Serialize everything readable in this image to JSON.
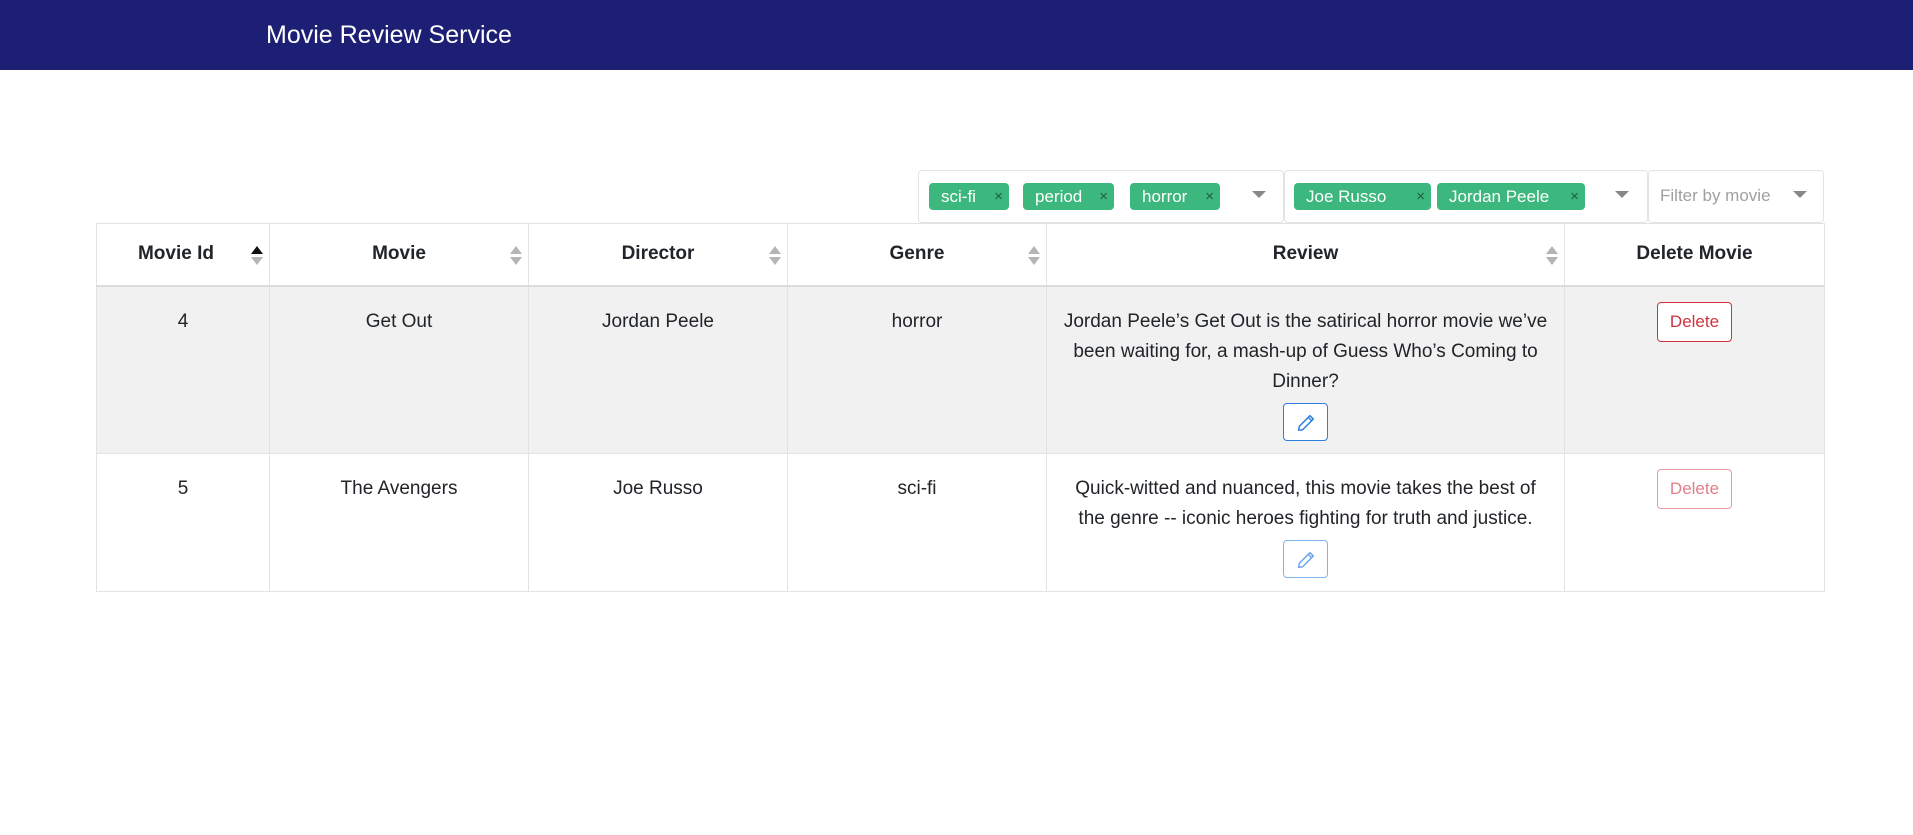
{
  "app": {
    "title": "Movie Review Service"
  },
  "filters": {
    "genre_chips": [
      "sci-fi",
      "period",
      "horror"
    ],
    "director_chips": [
      "Joe Russo",
      "Jordan Peele"
    ],
    "movie_placeholder": "Filter by movie",
    "chip_color": "#3cb77d"
  },
  "table": {
    "columns": [
      "Movie Id",
      "Movie",
      "Director",
      "Genre",
      "Review",
      "Delete Movie"
    ],
    "rows": [
      {
        "id": "4",
        "movie": "Get Out",
        "director": "Jordan Peele",
        "genre": "horror",
        "review": "Jordan Peele’s Get Out is the satirical horror movie we’ve been waiting for, a mash-up of Guess Who’s Coming to Dinner?",
        "delete_label": "Delete"
      },
      {
        "id": "5",
        "movie": "The Avengers",
        "director": "Joe Russo",
        "genre": "sci-fi",
        "review": "Quick-witted and nuanced, this movie takes the best of the genre -- iconic heroes fighting for truth and justice.",
        "delete_label": "Delete"
      }
    ]
  },
  "colors": {
    "navbar": "#1c1f73",
    "edit": "#2f7fe0",
    "delete": "#d0323f"
  },
  "icons": {
    "sort": "sort-arrows-icon",
    "edit": "pencil-icon",
    "dropdown": "caret-down-icon",
    "remove_chip": "close-icon"
  }
}
